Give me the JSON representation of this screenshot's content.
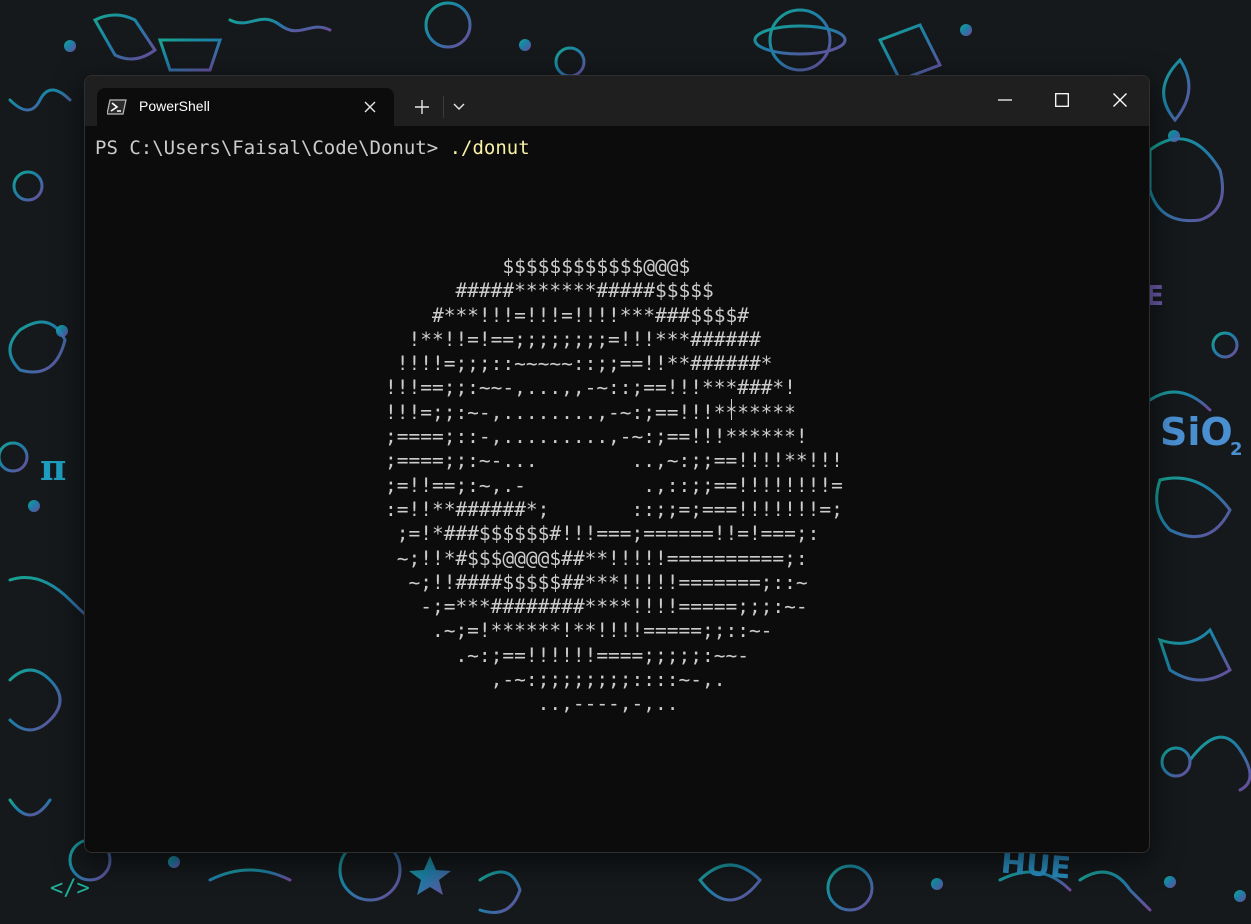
{
  "window": {
    "title": "PowerShell"
  },
  "tabs": [
    {
      "label": "PowerShell",
      "icon": "powershell-icon",
      "active": true
    }
  ],
  "titlebar": {
    "new_tab_icon": "plus-icon",
    "dropdown_icon": "chevron-down-icon",
    "minimize_icon": "minimize-icon",
    "maximize_icon": "maximize-icon",
    "close_icon": "close-icon"
  },
  "terminal": {
    "prompt": "PS C:\\Users\\Faisal\\Code\\Donut> ",
    "command": "./donut",
    "output_lines": [
      "          $$$$$$$$$$$$@@@$",
      "      #####*******#####$$$$$",
      "    #***!!!=!!!=!!!!***###$$$$#",
      "  !**!!=!==;;;;;;;;=!!!***######",
      " !!!!=;;;::~~~~~::;;==!!**######*",
      "!!!==;;:~~-,...,,-~::;==!!!***###*!",
      "!!!=;;:~-,........,-~:;==!!!*******",
      ";====;::-,.........,-~:;==!!!******!",
      ";====;;:~-...        ..,~:;;==!!!!**!!!",
      ";=!!==;:~,.-          .,::;;==!!!!!!!!=",
      ":=!!**######*;       ::;;=;===!!!!!!!=;",
      " ;=!*###$$$$$$#!!!===;======!!=!===;:",
      " ~;!!*#$$$@@@@$##**!!!!!==========;:",
      "  ~;!!####$$$$$##***!!!!!=======;::~",
      "   -;=***########****!!!!=====;;;:~-",
      "    .~;=!******!**!!!!=====;;::~-",
      "      .~:;==!!!!!!====;;;;;:~~-",
      "         ,-~:;;;;;;;;::::~-,.",
      "             ..,----,-,.."
    ]
  },
  "colors": {
    "terminal_bg": "#0c0c0c",
    "titlebar_bg": "#1f1f1f",
    "terminal_fg": "#cccccc",
    "command_fg": "#f9f1a5"
  }
}
